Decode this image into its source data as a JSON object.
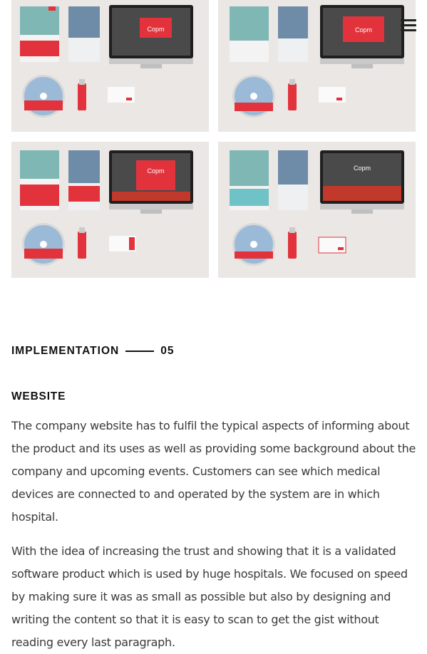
{
  "icons": {
    "menu": "hamburger-menu-icon"
  },
  "brand_color": "#e2333c",
  "mockups": [
    {
      "name": "mockup-stationery-1",
      "screen_logo": "Copm"
    },
    {
      "name": "mockup-stationery-2",
      "screen_logo": "Copm"
    },
    {
      "name": "mockup-stationery-3",
      "screen_logo": "Copm"
    },
    {
      "name": "mockup-stationery-4",
      "screen_logo": "Copm"
    }
  ],
  "section": {
    "label": "IMPLEMENTATION",
    "number": "05"
  },
  "content": {
    "heading": "WEBSITE",
    "paragraphs": [
      "The company website has to fulfil the typical aspects of informing about the product and its uses as well as providing some background about the company and upcoming events. Customers can see which medical devices are connected to and operated by the system are in which hospital.",
      "With the idea of increasing the trust and showing that it is a validated software product which is used by huge hospitals. We focused on speed by making sure it was as small as possible but also by designing and writing the content so that it is easy to scan to get the gist without reading every last paragraph."
    ]
  }
}
